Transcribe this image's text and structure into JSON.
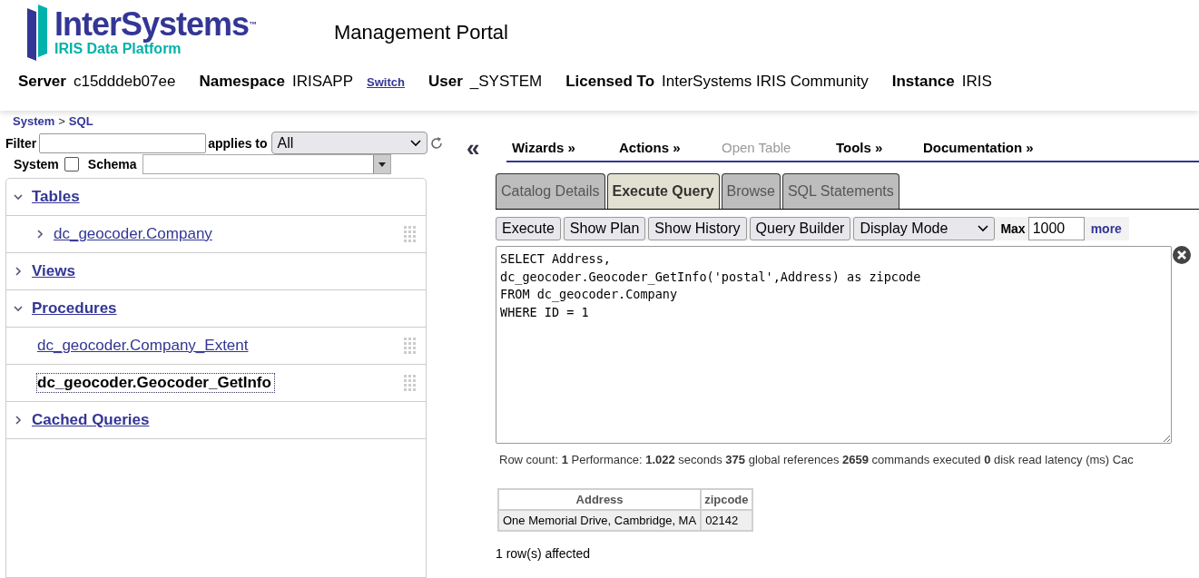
{
  "header": {
    "logo": {
      "name": "InterSystems",
      "tm": "™",
      "subtitle": "IRIS Data Platform"
    },
    "title": "Management Portal",
    "info": [
      {
        "label": "Server",
        "value": "c15dddeb07ee"
      },
      {
        "label": "Namespace",
        "value": "IRISAPP",
        "link": "Switch"
      },
      {
        "label": "User",
        "value": "_SYSTEM"
      },
      {
        "label": "Licensed To",
        "value": "InterSystems IRIS Community"
      },
      {
        "label": "Instance",
        "value": "IRIS"
      }
    ]
  },
  "breadcrumb": {
    "root": "System",
    "sep": ">",
    "current": "SQL"
  },
  "filter": {
    "label": "Filter",
    "applies_label": "applies to",
    "applies_value": "All",
    "system_label": "System",
    "system_checked": false,
    "schema_label": "Schema"
  },
  "tree": [
    {
      "label": "Tables",
      "expanded": true,
      "children": [
        {
          "label": "dc_geocoder.Company",
          "expandable": true,
          "selected": false
        }
      ]
    },
    {
      "label": "Views",
      "expanded": false
    },
    {
      "label": "Procedures",
      "expanded": true,
      "children": [
        {
          "label": "dc_geocoder.Company_Extent",
          "expandable": false,
          "selected": false
        },
        {
          "label": "dc_geocoder.Geocoder_GetInfo",
          "expandable": false,
          "selected": true
        }
      ]
    },
    {
      "label": "Cached Queries",
      "expanded": false
    }
  ],
  "collapse_glyph": "«",
  "menu": [
    {
      "label": "Wizards »",
      "disabled": false
    },
    {
      "label": "Actions »",
      "disabled": false
    },
    {
      "label": "Open Table",
      "disabled": true
    },
    {
      "label": "Tools »",
      "disabled": false
    },
    {
      "label": "Documentation »",
      "disabled": false
    }
  ],
  "tabs": [
    {
      "label": "Catalog Details",
      "selected": false
    },
    {
      "label": "Execute Query",
      "selected": true
    },
    {
      "label": "Browse",
      "selected": false
    },
    {
      "label": "SQL Statements",
      "selected": false
    }
  ],
  "toolbar": {
    "buttons": [
      "Execute",
      "Show Plan",
      "Show History",
      "Query Builder"
    ],
    "display_mode": "Display Mode",
    "max_label": "Max",
    "max_value": "1000",
    "more": "more"
  },
  "query": "SELECT Address,\ndc_geocoder.Geocoder_GetInfo('postal',Address) as zipcode\nFROM dc_geocoder.Company\nWHERE ID = 1",
  "stats": "Row count: **1** Performance: **1.022** seconds  **375** global references **2659** commands executed **0** disk read latency (ms)  Cac",
  "results": {
    "columns": [
      "Address",
      "zipcode"
    ],
    "rows": [
      [
        "One Memorial Drive, Cambridge, MA",
        "02142"
      ]
    ]
  },
  "affected": "1 row(s) affected"
}
